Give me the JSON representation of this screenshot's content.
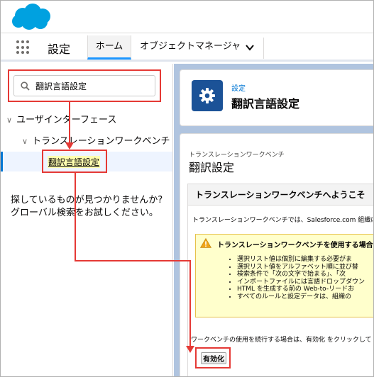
{
  "header": {
    "logo_icon": "salesforce-cloud-icon",
    "app_name": "設定",
    "tabs": [
      {
        "label": "ホーム"
      },
      {
        "label": "オブジェクトマネージャ"
      }
    ]
  },
  "sidebar": {
    "search": {
      "value": "翻訳言語設定",
      "icon": "search-icon"
    },
    "tree": {
      "level1": "ユーザインターフェース",
      "level2": "トランスレーションワークベンチ",
      "level3": "翻訳言語設定"
    },
    "not_found": "探しているものが見つかりませんか? グローバル検索をお試しください。"
  },
  "main": {
    "breadcrumb": "設定",
    "title": "翻訳言語設定",
    "section_sub": "トランスレーションワークベンチ",
    "section_title": "翻訳設定",
    "welcome_title": "トランスレーションワークベンチへようこそ",
    "intro": "トランスレーションワークベンチでは、Salesforce.com 組織に対",
    "warning": {
      "title": "トランスレーションワークベンチを使用する場合は",
      "items": [
        "選択リスト値は個別に編集する必要がま",
        "選択リスト値をアルファベット順に並び替",
        "検索条件で「次の文字で始まる」、「次",
        "インポートファイルには言語ドロップダウン",
        "HTML を生成する前の Web-to-リードお",
        "すべてのルールと設定データは、組織の"
      ]
    },
    "continue_text": "ワークベンチの使用を続行する場合は、有効化 をクリックして",
    "enable_label": "有効化"
  },
  "colors": {
    "brand_blue": "#00a1e0",
    "highlight_red": "#e53935",
    "setup_tile": "#1b5297",
    "warning_bg": "#ffffcc"
  }
}
